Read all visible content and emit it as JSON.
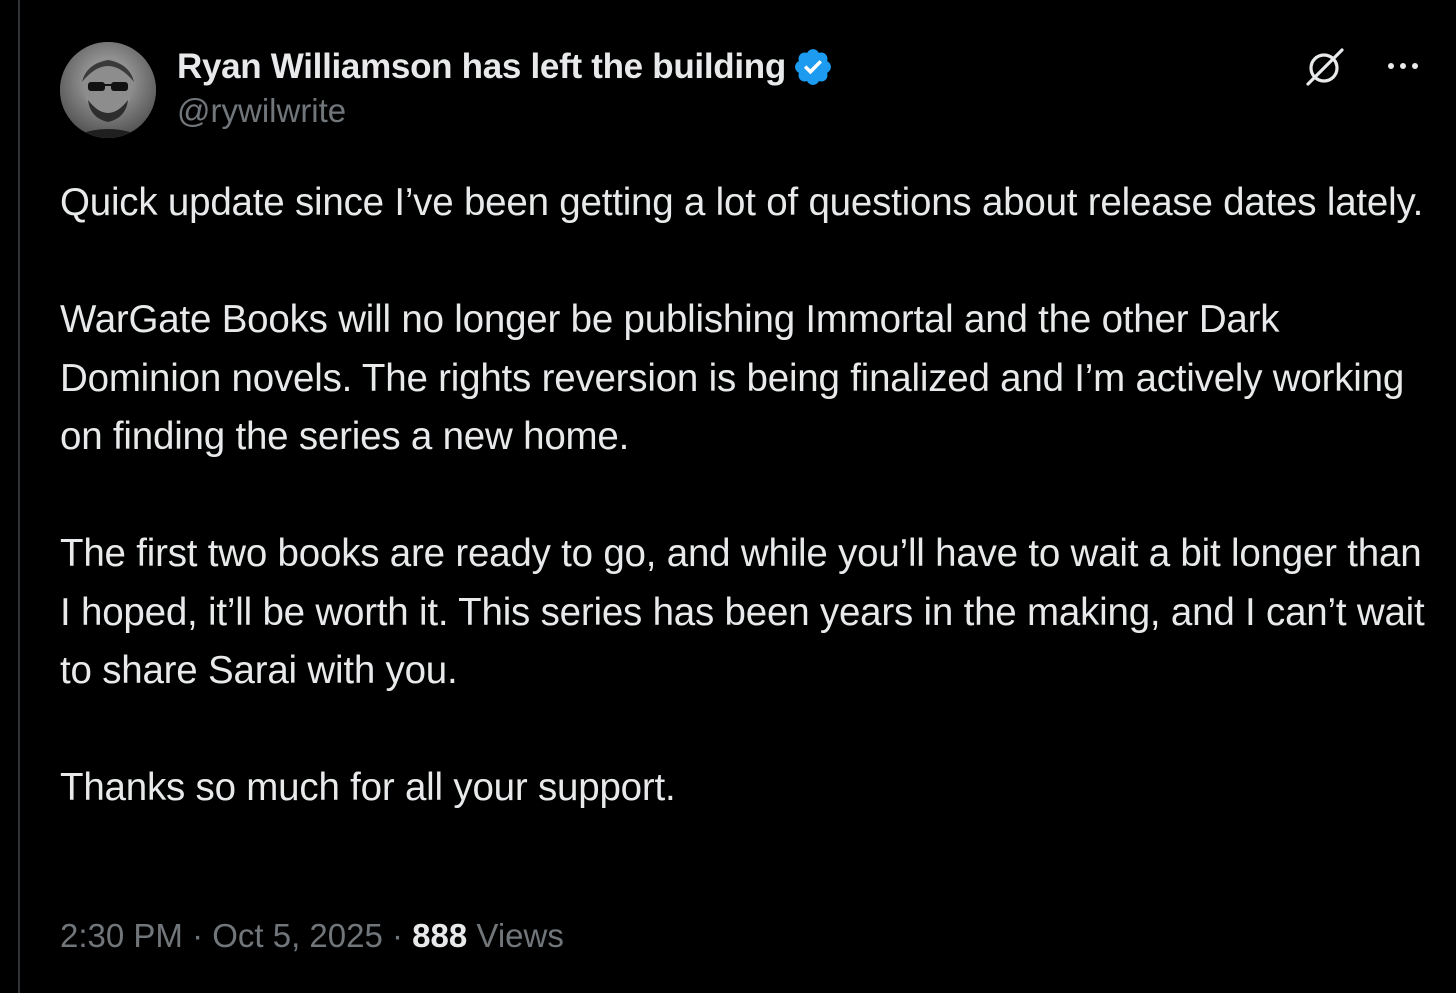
{
  "author": {
    "display_name": "Ryan Williamson has left the building",
    "handle": "@rywilwrite",
    "verified_icon": "verified-badge-icon",
    "avatar_icon": "avatar"
  },
  "header_actions": {
    "grok_icon": "grok-icon",
    "more_icon": "more-icon"
  },
  "post": {
    "paragraphs": [
      "Quick update since I’ve been getting a lot of questions about release dates lately.",
      "WarGate Books will no longer be publishing Immortal and the other Dark Dominion novels. The rights reversion is being finalized and I’m actively working on finding the series a new home.",
      "The first two books are ready to go, and while you’ll have to wait a bit longer than I hoped, it’ll be worth it. This series has been years in the making, and I can’t wait to share Sarai with you.",
      "Thanks so much for all your support."
    ]
  },
  "meta": {
    "time": "2:30 PM",
    "separator": " · ",
    "date": "Oct 5, 2025",
    "views_count": "888",
    "views_label": "Views"
  },
  "colors": {
    "background": "#000000",
    "text_primary": "#e7e9ea",
    "text_secondary": "#71767b",
    "verified_blue": "#1d9bf0"
  }
}
